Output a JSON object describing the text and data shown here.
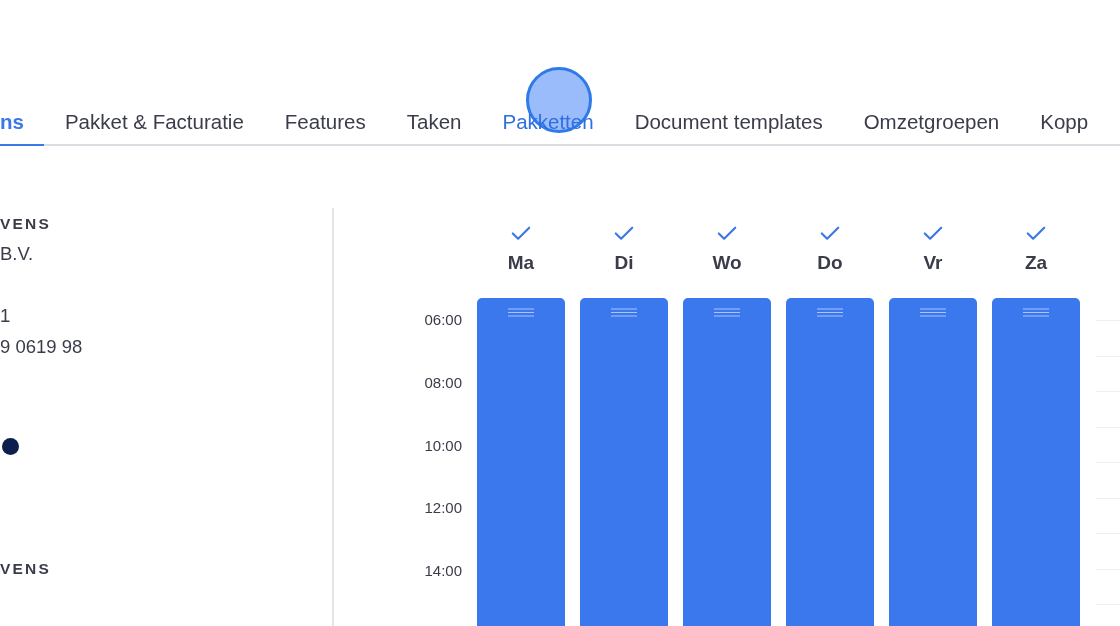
{
  "tabs": [
    {
      "label": "ns",
      "selected": true,
      "hovered": false
    },
    {
      "label": "Pakket & Facturatie",
      "selected": false,
      "hovered": false
    },
    {
      "label": "Features",
      "selected": false,
      "hovered": false
    },
    {
      "label": "Taken",
      "selected": false,
      "hovered": false
    },
    {
      "label": "Pakketten",
      "selected": false,
      "hovered": true
    },
    {
      "label": "Document templates",
      "selected": false,
      "hovered": false
    },
    {
      "label": "Omzetgroepen",
      "selected": false,
      "hovered": false
    },
    {
      "label": "Kopp",
      "selected": false,
      "hovered": false
    }
  ],
  "info_panel": {
    "items": [
      {
        "kind": "heading",
        "text": "VENS"
      },
      {
        "kind": "text",
        "text": "B.V."
      },
      {
        "kind": "spacer"
      },
      {
        "kind": "text",
        "text": "1"
      },
      {
        "kind": "text",
        "text": "9 0619 98"
      },
      {
        "kind": "dot",
        "color": "#0c1f4f"
      },
      {
        "kind": "heading",
        "text": "VENS"
      }
    ]
  },
  "schedule": {
    "days": [
      {
        "label": "Ma",
        "checked": true
      },
      {
        "label": "Di",
        "checked": true
      },
      {
        "label": "Wo",
        "checked": true
      },
      {
        "label": "Do",
        "checked": true
      },
      {
        "label": "Vr",
        "checked": true
      },
      {
        "label": "Za",
        "checked": true
      }
    ],
    "times": [
      "06:00",
      "08:00",
      "10:00",
      "12:00",
      "14:00"
    ]
  }
}
